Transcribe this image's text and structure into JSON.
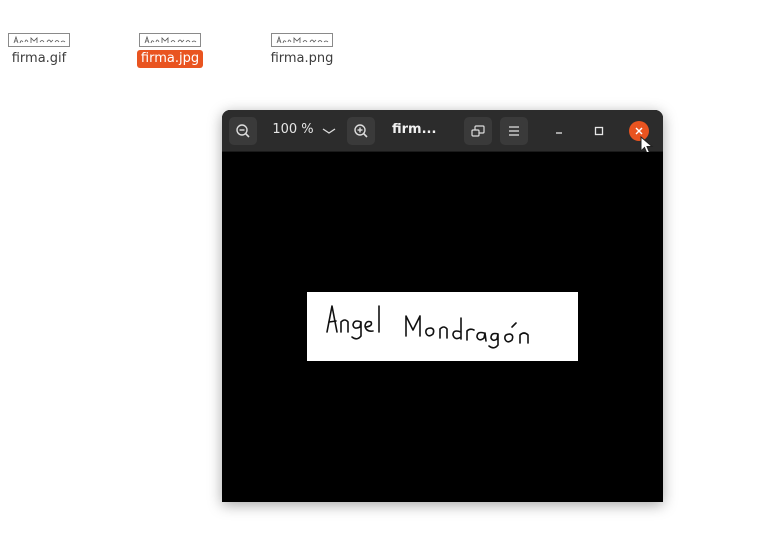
{
  "desktop": {
    "files": [
      {
        "name": "firma.gif",
        "selected": false
      },
      {
        "name": "firma.jpg",
        "selected": true
      },
      {
        "name": "firma.png",
        "selected": false
      }
    ],
    "selection_color": "#e95420"
  },
  "viewer": {
    "title": "firm...",
    "zoom_label": "100 %",
    "icons": {
      "zoom_out": "zoom-out-icon",
      "zoom_dropdown": "chevron-down-icon",
      "zoom_in": "zoom-in-icon",
      "fullscreen": "fullscreen-icon",
      "menu": "hamburger-menu-icon",
      "minimize": "minimize-icon",
      "maximize": "maximize-icon",
      "close": "close-icon"
    },
    "header_color": "#2c2c2c",
    "canvas_color": "#000000",
    "close_color": "#e95420",
    "image": {
      "signature_text": "Angel Mondragon"
    }
  }
}
